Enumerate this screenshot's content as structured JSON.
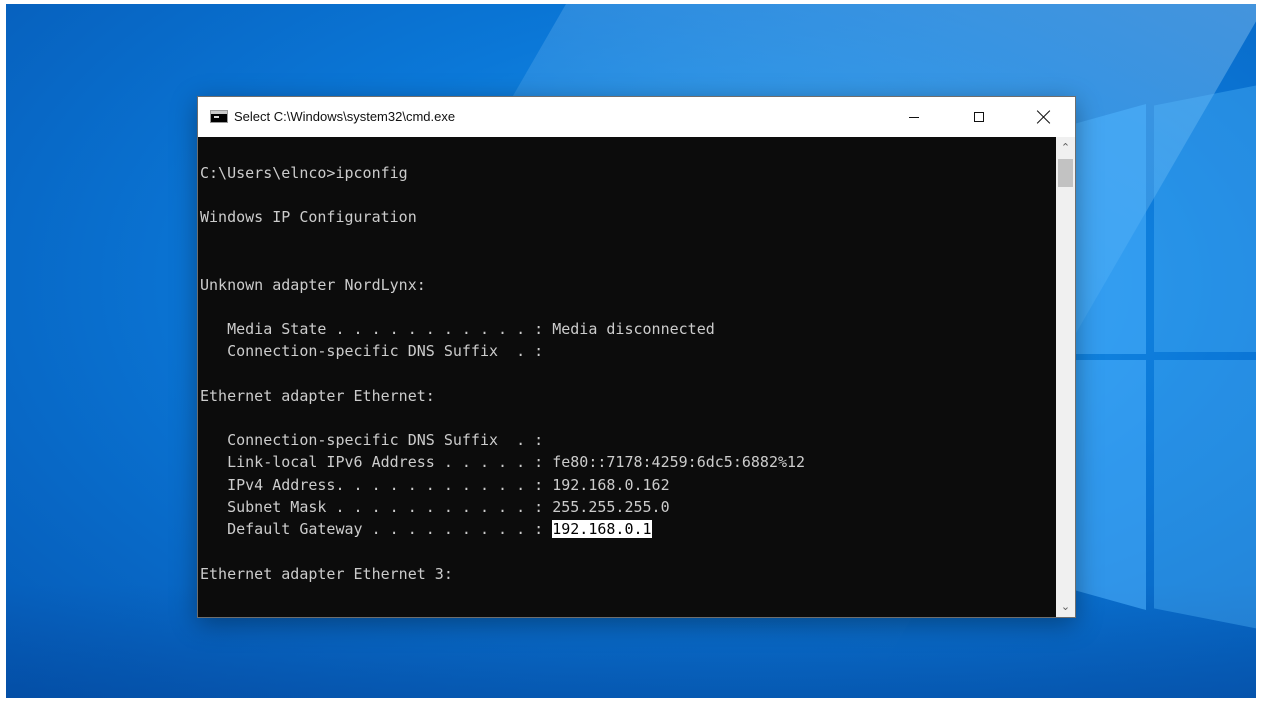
{
  "window": {
    "title": "Select C:\\Windows\\system32\\cmd.exe",
    "icon": "cmd-console-icon"
  },
  "controls": {
    "minimize_icon": "minimize-icon",
    "maximize_icon": "maximize-icon",
    "close_icon": "close-icon"
  },
  "console": {
    "lines": [
      "C:\\Users\\elnco>ipconfig",
      "Windows IP Configuration",
      "Unknown adapter NordLynx:",
      "   Media State . . . . . . . . . . . : Media disconnected",
      "   Connection-specific DNS Suffix  . :",
      "Ethernet adapter Ethernet:",
      "   Connection-specific DNS Suffix  . :",
      "   Link-local IPv6 Address . . . . . : fe80::7178:4259:6dc5:6882%12",
      "   IPv4 Address. . . . . . . . . . . : 192.168.0.162",
      "   Subnet Mask . . . . . . . . . . . : 255.255.255.0",
      "   Default Gateway . . . . . . . . . : ",
      "Ethernet adapter Ethernet 3:"
    ],
    "selected_text": "192.168.0.1"
  },
  "scrollbar": {
    "up_glyph": "⌃",
    "down_glyph": "⌄"
  },
  "colors": {
    "console_bg": "#0c0c0c",
    "console_fg": "#cccccc",
    "selection_bg": "#ffffff",
    "desktop_accent": "#0b78d8"
  }
}
